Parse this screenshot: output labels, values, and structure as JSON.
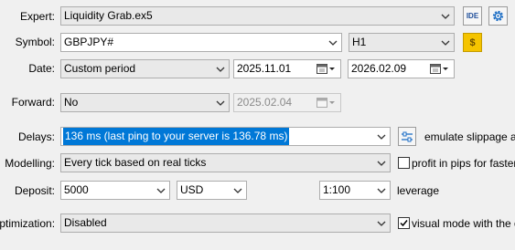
{
  "labels": {
    "expert": "Expert:",
    "symbol": "Symbol:",
    "date": "Date:",
    "forward": "Forward:",
    "delays": "Delays:",
    "modelling": "Modelling:",
    "deposit": "Deposit:",
    "optimization": "Optimization:"
  },
  "expert": {
    "value": "Liquidity Grab.ex5",
    "ide_label": "IDE"
  },
  "symbol": {
    "value": "GBPJPY#",
    "timeframe": "H1"
  },
  "date": {
    "period": "Custom period",
    "from": "2025.11.01",
    "to": "2026.02.09"
  },
  "forward": {
    "value": "No",
    "date": "2025.02.04"
  },
  "delays": {
    "value": "136 ms (last ping to your server is 136.78 ms)",
    "emulate_label": "emulate slippage and"
  },
  "modelling": {
    "value": "Every tick based on real ticks",
    "profit_label": "profit in pips for faster ca",
    "profit_checked": false
  },
  "deposit": {
    "amount": "5000",
    "currency": "USD",
    "leverage": "1:100",
    "leverage_label": "leverage"
  },
  "optimization": {
    "value": "Disabled",
    "visual_label": "visual mode with the disp",
    "visual_checked": true
  },
  "colors": {
    "selection": "#0078d7",
    "symbol_button": "#f5c400",
    "settings_icon": "#1f6fc5"
  }
}
